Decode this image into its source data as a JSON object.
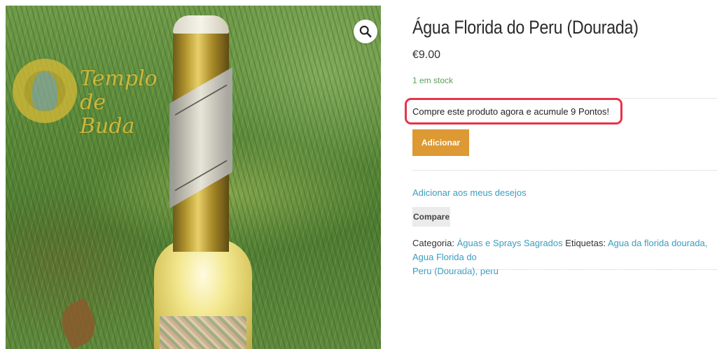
{
  "gallery": {
    "watermark_text": "Templo de Buda",
    "zoom_icon": "magnifier-icon"
  },
  "product": {
    "title": "Água Florida do Peru (Dourada)",
    "price": "€9.00",
    "stock": "1 em stock",
    "points_message": "Compre este produto agora e acumule 9 Pontos!",
    "add_to_cart_label": "Adicionar",
    "wishlist_label": "Adicionar aos meus desejos",
    "compare_label": "Compare"
  },
  "meta": {
    "category_label": "Categoria:",
    "category": "Águas e Sprays Sagrados",
    "tags_label": "Etiquetas:",
    "tags": [
      "Agua da florida dourada,",
      "Agua Florida do",
      "Peru (Dourada),",
      "peru"
    ]
  },
  "colors": {
    "accent_button": "#dd9933",
    "link": "#3a9dbf",
    "highlight_border": "#e8334a",
    "stock": "#5aa05a"
  }
}
